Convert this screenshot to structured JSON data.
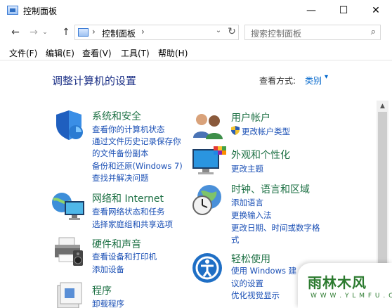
{
  "window": {
    "title": "控制面板",
    "minimize": "—",
    "maximize": "☐",
    "close": "✕"
  },
  "nav": {
    "back": "←",
    "forward": "→",
    "history": "⌄",
    "up": "↑",
    "address_sep": "›",
    "address_path": "控制面板",
    "address_dropdown": "⌄",
    "refresh": "↻",
    "search_placeholder": "搜索控制面板",
    "search_icon": "⌕"
  },
  "menu": [
    "文件(F)",
    "编辑(E)",
    "查看(V)",
    "工具(T)",
    "帮助(H)"
  ],
  "main": {
    "heading": "调整计算机的设置",
    "view_by_label": "查看方式:",
    "view_by_value": "类别",
    "view_by_caret": "▾"
  },
  "left_categories": [
    {
      "title": "系统和安全",
      "icon": "shield-icon",
      "links": [
        "查看你的计算机状态",
        "通过文件历史记录保存你",
        "的文件备份副本",
        "备份和还原(Windows 7)",
        "查找并解决问题"
      ]
    },
    {
      "title": "网络和 Internet",
      "icon": "network-icon",
      "links": [
        "查看网络状态和任务",
        "选择家庭组和共享选项"
      ]
    },
    {
      "title": "硬件和声音",
      "icon": "printer-icon",
      "links": [
        "查看设备和打印机",
        "添加设备"
      ]
    },
    {
      "title": "程序",
      "icon": "programs-icon",
      "links": [
        "卸载程序"
      ]
    }
  ],
  "right_categories": [
    {
      "title": "用户帐户",
      "icon": "users-icon",
      "links": [
        "更改帐户类型"
      ]
    },
    {
      "title": "外观和个性化",
      "icon": "monitor-icon",
      "links": [
        "更改主题"
      ]
    },
    {
      "title": "时钟、语言和区域",
      "icon": "clock-globe-icon",
      "links": [
        "添加语言",
        "更换输入法",
        "更改日期、时间或数字格",
        "式"
      ]
    },
    {
      "title": "轻松使用",
      "icon": "ease-of-access-icon",
      "links": [
        "使用 Windows 建",
        "议的设置",
        "优化视觉显示"
      ]
    }
  ],
  "scrollbar": {
    "up_arrow": "▲"
  },
  "watermark": {
    "main": "雨林木风",
    "sub": "W W W . Y L M F U . C O M"
  },
  "colors": {
    "category_title": "#1e7145",
    "link": "#1a4fb5",
    "heading": "#1e3287",
    "accent": "#0066cc"
  }
}
